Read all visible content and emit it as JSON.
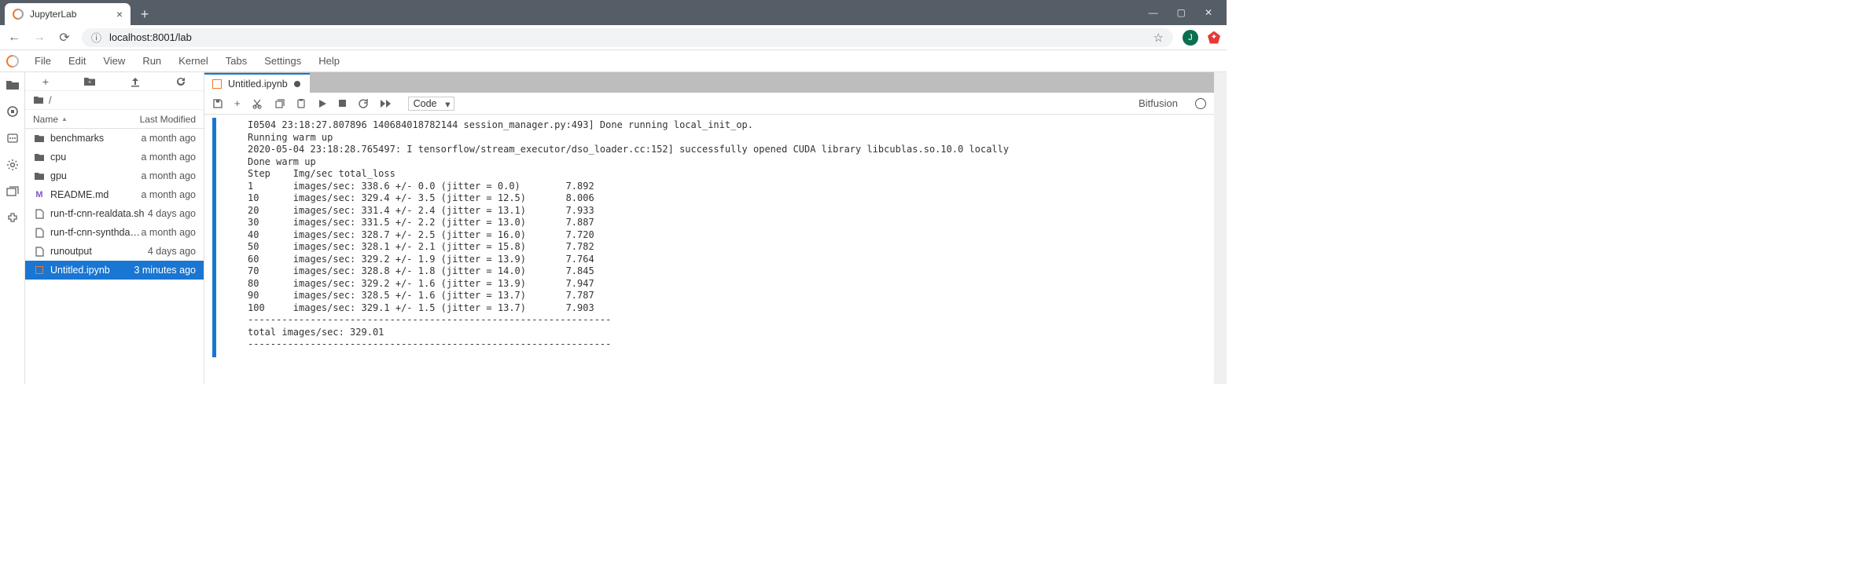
{
  "browser": {
    "tab_title": "JupyterLab",
    "url": "localhost:8001/lab",
    "avatar_letter": "J"
  },
  "menubar": [
    "File",
    "Edit",
    "View",
    "Run",
    "Kernel",
    "Tabs",
    "Settings",
    "Help"
  ],
  "filebrowser": {
    "breadcrumb": "/",
    "columns": {
      "name": "Name",
      "modified": "Last Modified"
    },
    "files": [
      {
        "kind": "folder",
        "name": "benchmarks",
        "modified": "a month ago"
      },
      {
        "kind": "folder",
        "name": "cpu",
        "modified": "a month ago"
      },
      {
        "kind": "folder",
        "name": "gpu",
        "modified": "a month ago"
      },
      {
        "kind": "markdown",
        "name": "README.md",
        "modified": "a month ago"
      },
      {
        "kind": "file",
        "name": "run-tf-cnn-realdata.sh",
        "modified": "4 days ago"
      },
      {
        "kind": "file",
        "name": "run-tf-cnn-synthdata.sh",
        "modified": "a month ago"
      },
      {
        "kind": "file",
        "name": "runoutput",
        "modified": "4 days ago"
      },
      {
        "kind": "notebook",
        "name": "Untitled.ipynb",
        "modified": "3 minutes ago",
        "selected": true
      }
    ]
  },
  "notebook": {
    "tab_name": "Untitled.ipynb",
    "cell_type": "Code",
    "right_label": "Bitfusion",
    "output": "I0504 23:18:27.807896 140684018782144 session_manager.py:493] Done running local_init_op.\nRunning warm up\n2020-05-04 23:18:28.765497: I tensorflow/stream_executor/dso_loader.cc:152] successfully opened CUDA library libcublas.so.10.0 locally\nDone warm up\nStep    Img/sec total_loss\n1       images/sec: 338.6 +/- 0.0 (jitter = 0.0)        7.892\n10      images/sec: 329.4 +/- 3.5 (jitter = 12.5)       8.006\n20      images/sec: 331.4 +/- 2.4 (jitter = 13.1)       7.933\n30      images/sec: 331.5 +/- 2.2 (jitter = 13.0)       7.887\n40      images/sec: 328.7 +/- 2.5 (jitter = 16.0)       7.720\n50      images/sec: 328.1 +/- 2.1 (jitter = 15.8)       7.782\n60      images/sec: 329.2 +/- 1.9 (jitter = 13.9)       7.764\n70      images/sec: 328.8 +/- 1.8 (jitter = 14.0)       7.845\n80      images/sec: 329.2 +/- 1.6 (jitter = 13.9)       7.947\n90      images/sec: 328.5 +/- 1.6 (jitter = 13.7)       7.787\n100     images/sec: 329.1 +/- 1.5 (jitter = 13.7)       7.903\n----------------------------------------------------------------\ntotal images/sec: 329.01\n----------------------------------------------------------------"
  }
}
